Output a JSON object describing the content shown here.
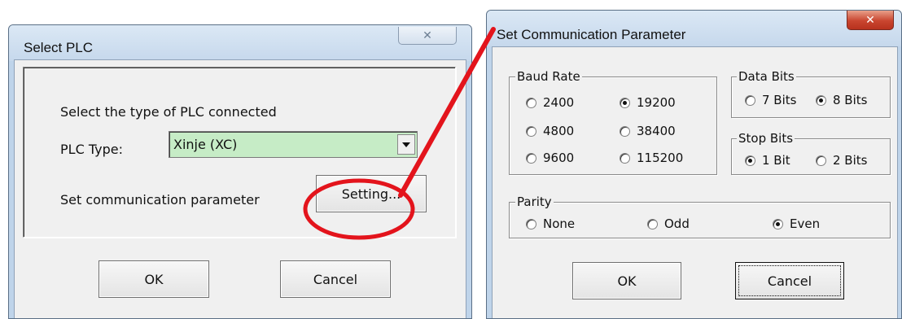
{
  "select_plc": {
    "title": "Select PLC",
    "prompt": "Select the type of PLC connected",
    "plc_type_label": "PLC Type:",
    "plc_type_value": "Xinje (XC)",
    "comm_label": "Set communication parameter",
    "setting_button": "Setting...",
    "ok_button": "OK",
    "cancel_button": "Cancel"
  },
  "comm_params": {
    "title": "Set Communication Parameter",
    "baud_rate": {
      "title": "Baud Rate",
      "options": [
        "2400",
        "19200",
        "4800",
        "38400",
        "9600",
        "115200"
      ],
      "selected": "19200"
    },
    "data_bits": {
      "title": "Data Bits",
      "options": [
        "7 Bits",
        "8 Bits"
      ],
      "selected": "8 Bits"
    },
    "stop_bits": {
      "title": "Stop Bits",
      "options": [
        "1 Bit",
        "2 Bits"
      ],
      "selected": "1 Bit"
    },
    "parity": {
      "title": "Parity",
      "options": [
        "None",
        "Odd",
        "Even"
      ],
      "selected": "Even"
    },
    "ok_button": "OK",
    "cancel_button": "Cancel"
  },
  "colors": {
    "plc_type_field": "#c6ecc6",
    "annotation_red": "#e3141c",
    "close_button_red": "#c9452f"
  },
  "icons": {
    "close": "close-icon",
    "dropdown": "chevron-down-icon"
  }
}
